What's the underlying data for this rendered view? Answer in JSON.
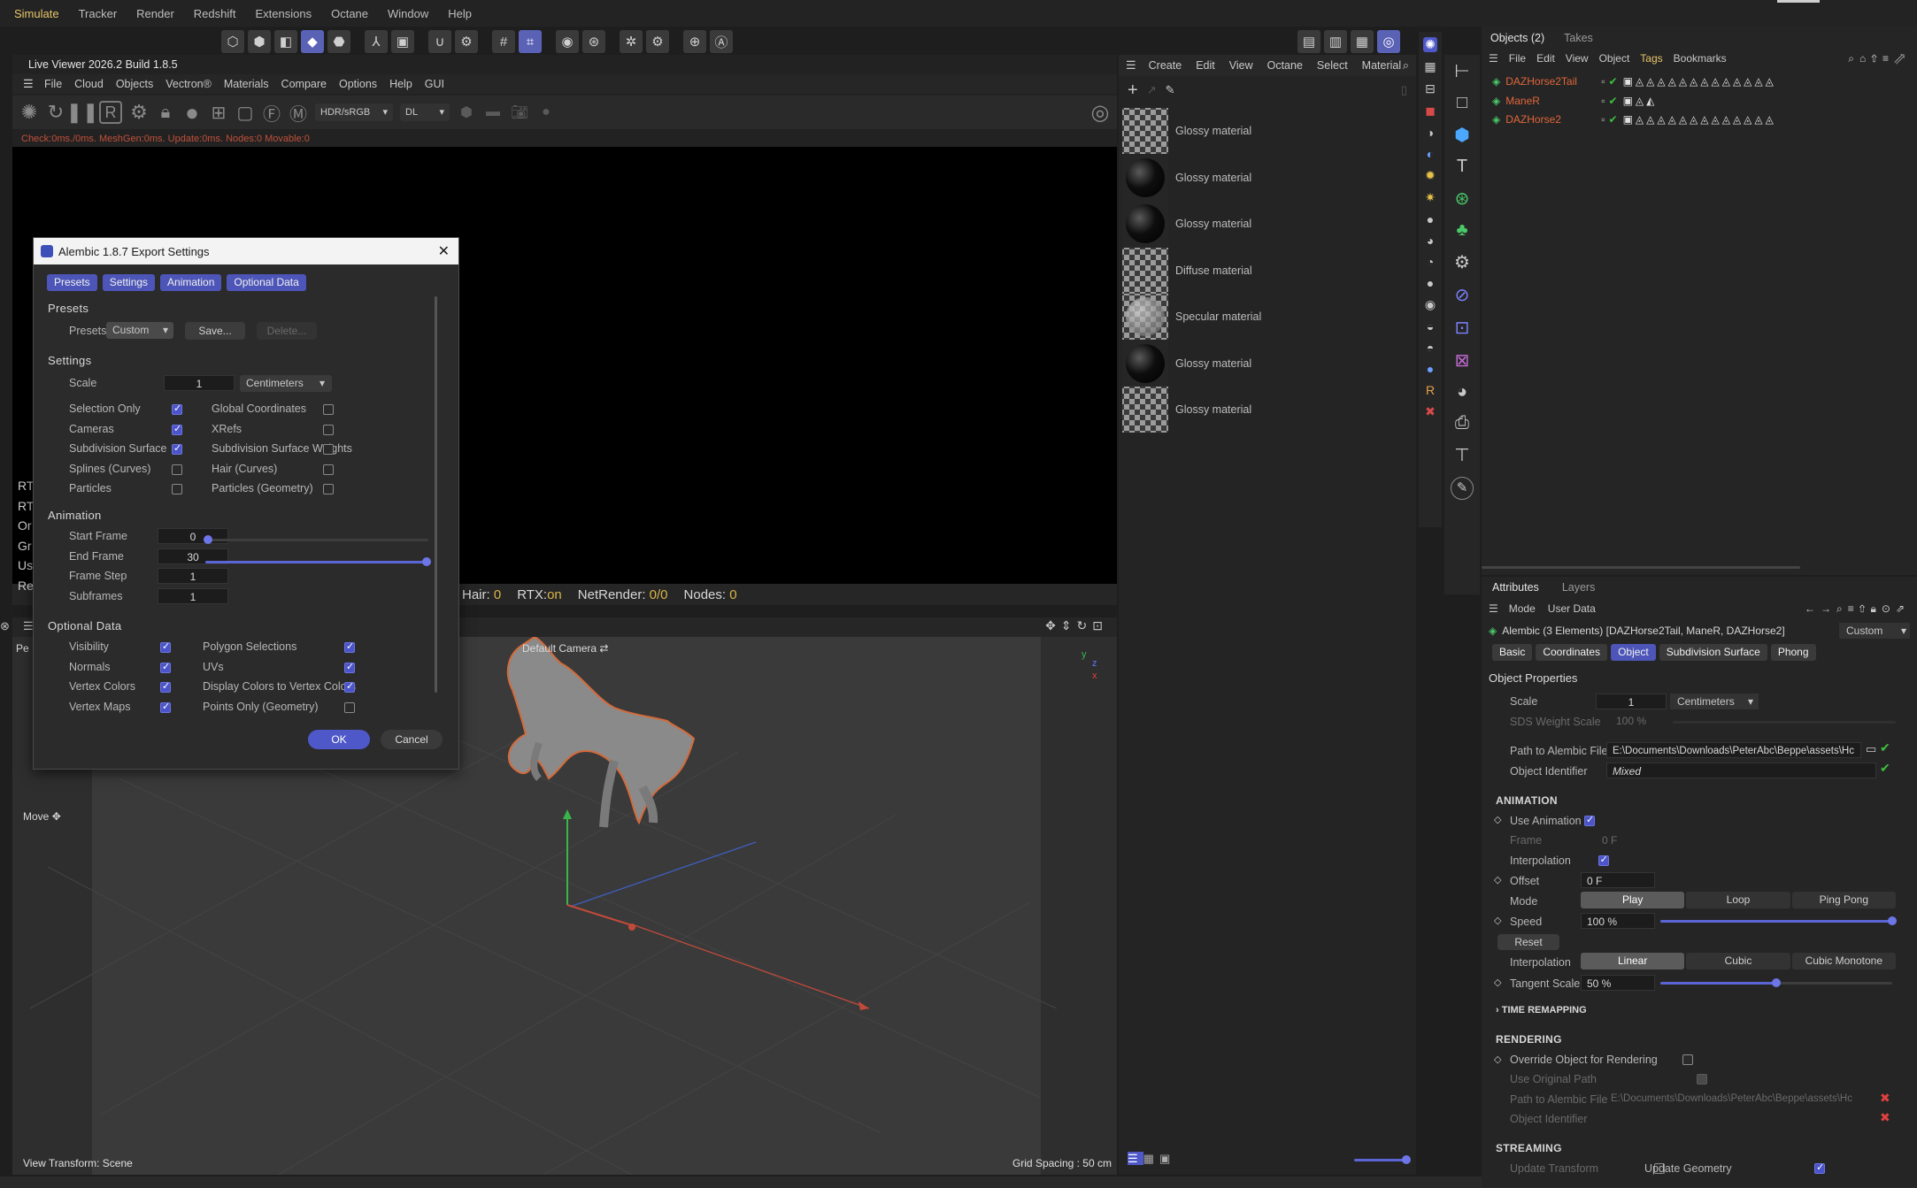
{
  "main_menu": [
    "Simulate",
    "Tracker",
    "Render",
    "Redshift",
    "Extensions",
    "Octane",
    "Window",
    "Help"
  ],
  "live_viewer": {
    "title": "Live Viewer 2026.2 Build 1.8.5",
    "menu": [
      "File",
      "Cloud",
      "Objects",
      "Vectron®",
      "Materials",
      "Compare",
      "Options",
      "Help",
      "GUI"
    ],
    "color_space": "HDR/sRGB",
    "kernel": "DL",
    "status_text": "Check:0ms./0ms. MeshGen:0ms. Update:0ms. Nodes:0 Movable:0",
    "stats": {
      "hair_label": "Hair:",
      "hair_val": "0",
      "rtx_label": "RTX:",
      "rtx_val": "on",
      "net_label": "NetRender:",
      "net_val": "0/0",
      "nodes_label": "Nodes:",
      "nodes_val": "0"
    },
    "side_fragments": [
      "RT",
      "RT",
      "Or",
      "Gr",
      "Us",
      "Re"
    ]
  },
  "viewport": {
    "camera_label": "Default Camera",
    "move_label": "Move",
    "view_transform": "View Transform: Scene",
    "grid_spacing": "Grid Spacing : 50 cm",
    "pe_fragment": "Pe"
  },
  "dialog": {
    "title": "Alembic 1.8.7 Export Settings",
    "tabs": [
      "Presets",
      "Settings",
      "Animation",
      "Optional Data"
    ],
    "presets_heading": "Presets",
    "presets_label": "Presets",
    "presets_value": "Custom",
    "save_label": "Save...",
    "delete_label": "Delete...",
    "settings_heading": "Settings",
    "scale_label": "Scale",
    "scale_value": "1",
    "scale_unit": "Centimeters",
    "left_checks": [
      {
        "label": "Selection Only",
        "on": true
      },
      {
        "label": "Cameras",
        "on": true
      },
      {
        "label": "Subdivision Surface",
        "on": true
      },
      {
        "label": "Splines (Curves)",
        "on": false
      },
      {
        "label": "Particles",
        "on": false
      }
    ],
    "right_checks": [
      {
        "label": "Global Coordinates",
        "on": false
      },
      {
        "label": "XRefs",
        "on": false
      },
      {
        "label": "Subdivision Surface Weights",
        "on": false
      },
      {
        "label": "Hair (Curves)",
        "on": false
      },
      {
        "label": "Particles (Geometry)",
        "on": false
      }
    ],
    "animation_heading": "Animation",
    "anim_fields": [
      {
        "label": "Start Frame",
        "value": "0"
      },
      {
        "label": "End Frame",
        "value": "30"
      },
      {
        "label": "Frame Step",
        "value": "1"
      },
      {
        "label": "Subframes",
        "value": "1"
      }
    ],
    "optional_heading": "Optional Data",
    "opt_left": [
      {
        "label": "Visibility",
        "on": true
      },
      {
        "label": "Normals",
        "on": true
      },
      {
        "label": "Vertex Colors",
        "on": true
      },
      {
        "label": "Vertex Maps",
        "on": true
      }
    ],
    "opt_right": [
      {
        "label": "Polygon Selections",
        "on": true
      },
      {
        "label": "UVs",
        "on": true
      },
      {
        "label": "Display Colors to Vertex Colors",
        "on": true
      },
      {
        "label": "Points Only (Geometry)",
        "on": false
      }
    ],
    "ok_label": "OK",
    "cancel_label": "Cancel"
  },
  "material_panel": {
    "menu": [
      "Create",
      "Edit",
      "View",
      "Octane",
      "Select",
      "Material"
    ],
    "materials": [
      {
        "name": "Glossy material",
        "type": "checker-top"
      },
      {
        "name": "Glossy material",
        "type": "ball"
      },
      {
        "name": "Glossy material",
        "type": "ball"
      },
      {
        "name": "Diffuse material",
        "type": "checker"
      },
      {
        "name": "Specular material",
        "type": "checker-ball"
      },
      {
        "name": "Glossy material",
        "type": "ball"
      },
      {
        "name": "Glossy material",
        "type": "checker"
      }
    ]
  },
  "objects_panel": {
    "tabs": [
      "Objects (2)",
      "Takes"
    ],
    "menu": [
      "File",
      "Edit",
      "View",
      "Object",
      "Tags",
      "Bookmarks"
    ],
    "objects": [
      "DAZHorse2Tail",
      "ManeR",
      "DAZHorse2"
    ],
    "name_color": "#e0673a"
  },
  "attributes": {
    "tabs": [
      "Attributes",
      "Layers"
    ],
    "menu": [
      "Mode",
      "User Data"
    ],
    "object_title": "Alembic (3 Elements) [DAZHorse2Tail, ManeR, DAZHorse2]",
    "preset": "Custom",
    "subtabs": [
      "Basic",
      "Coordinates",
      "Object",
      "Subdivision Surface",
      "Phong"
    ],
    "object_properties": "Object Properties",
    "scale_label": "Scale",
    "scale_value": "1",
    "scale_unit": "Centimeters",
    "sds_label": "SDS Weight Scale",
    "sds_value": "100 %",
    "path_label": "Path to Alembic File",
    "path_value": "E:\\Documents\\Downloads\\PeterAbc\\Beppe\\assets\\Hc",
    "identifier_label": "Object Identifier",
    "identifier_value": "Mixed",
    "animation_heading": "ANIMATION",
    "use_animation": "Use Animation",
    "frame_label": "Frame",
    "frame_value": "0 F",
    "interpolation_check": "Interpolation",
    "offset_label": "Offset",
    "offset_value": "0 F",
    "mode_label": "Mode",
    "mode_options": [
      "Play",
      "Loop",
      "Ping Pong"
    ],
    "speed_label": "Speed",
    "speed_value": "100 %",
    "speed_fraction": 1.0,
    "reset_label": "Reset",
    "interp_label": "Interpolation",
    "interp_options": [
      "Linear",
      "Cubic",
      "Cubic Monotone"
    ],
    "tangent_label": "Tangent Scale",
    "tangent_value": "50 %",
    "tangent_fraction": 0.5,
    "time_remap": "TIME REMAPPING",
    "rendering_heading": "RENDERING",
    "override_label": "Override Object for Rendering",
    "use_original_path": "Use Original Path",
    "render_path_label": "Path to Alembic File",
    "render_path_value": "E:\\Documents\\Downloads\\PeterAbc\\Beppe\\assets\\Hc",
    "render_identifier": "Object Identifier",
    "streaming_heading": "STREAMING",
    "update_transform": "Update Transform",
    "update_geometry": "Update Geometry"
  },
  "colors": {
    "accent": "#5b65d6",
    "selection_orange": "#e0673a",
    "check_green": "#3fbf3f",
    "error_red": "#e04040"
  }
}
